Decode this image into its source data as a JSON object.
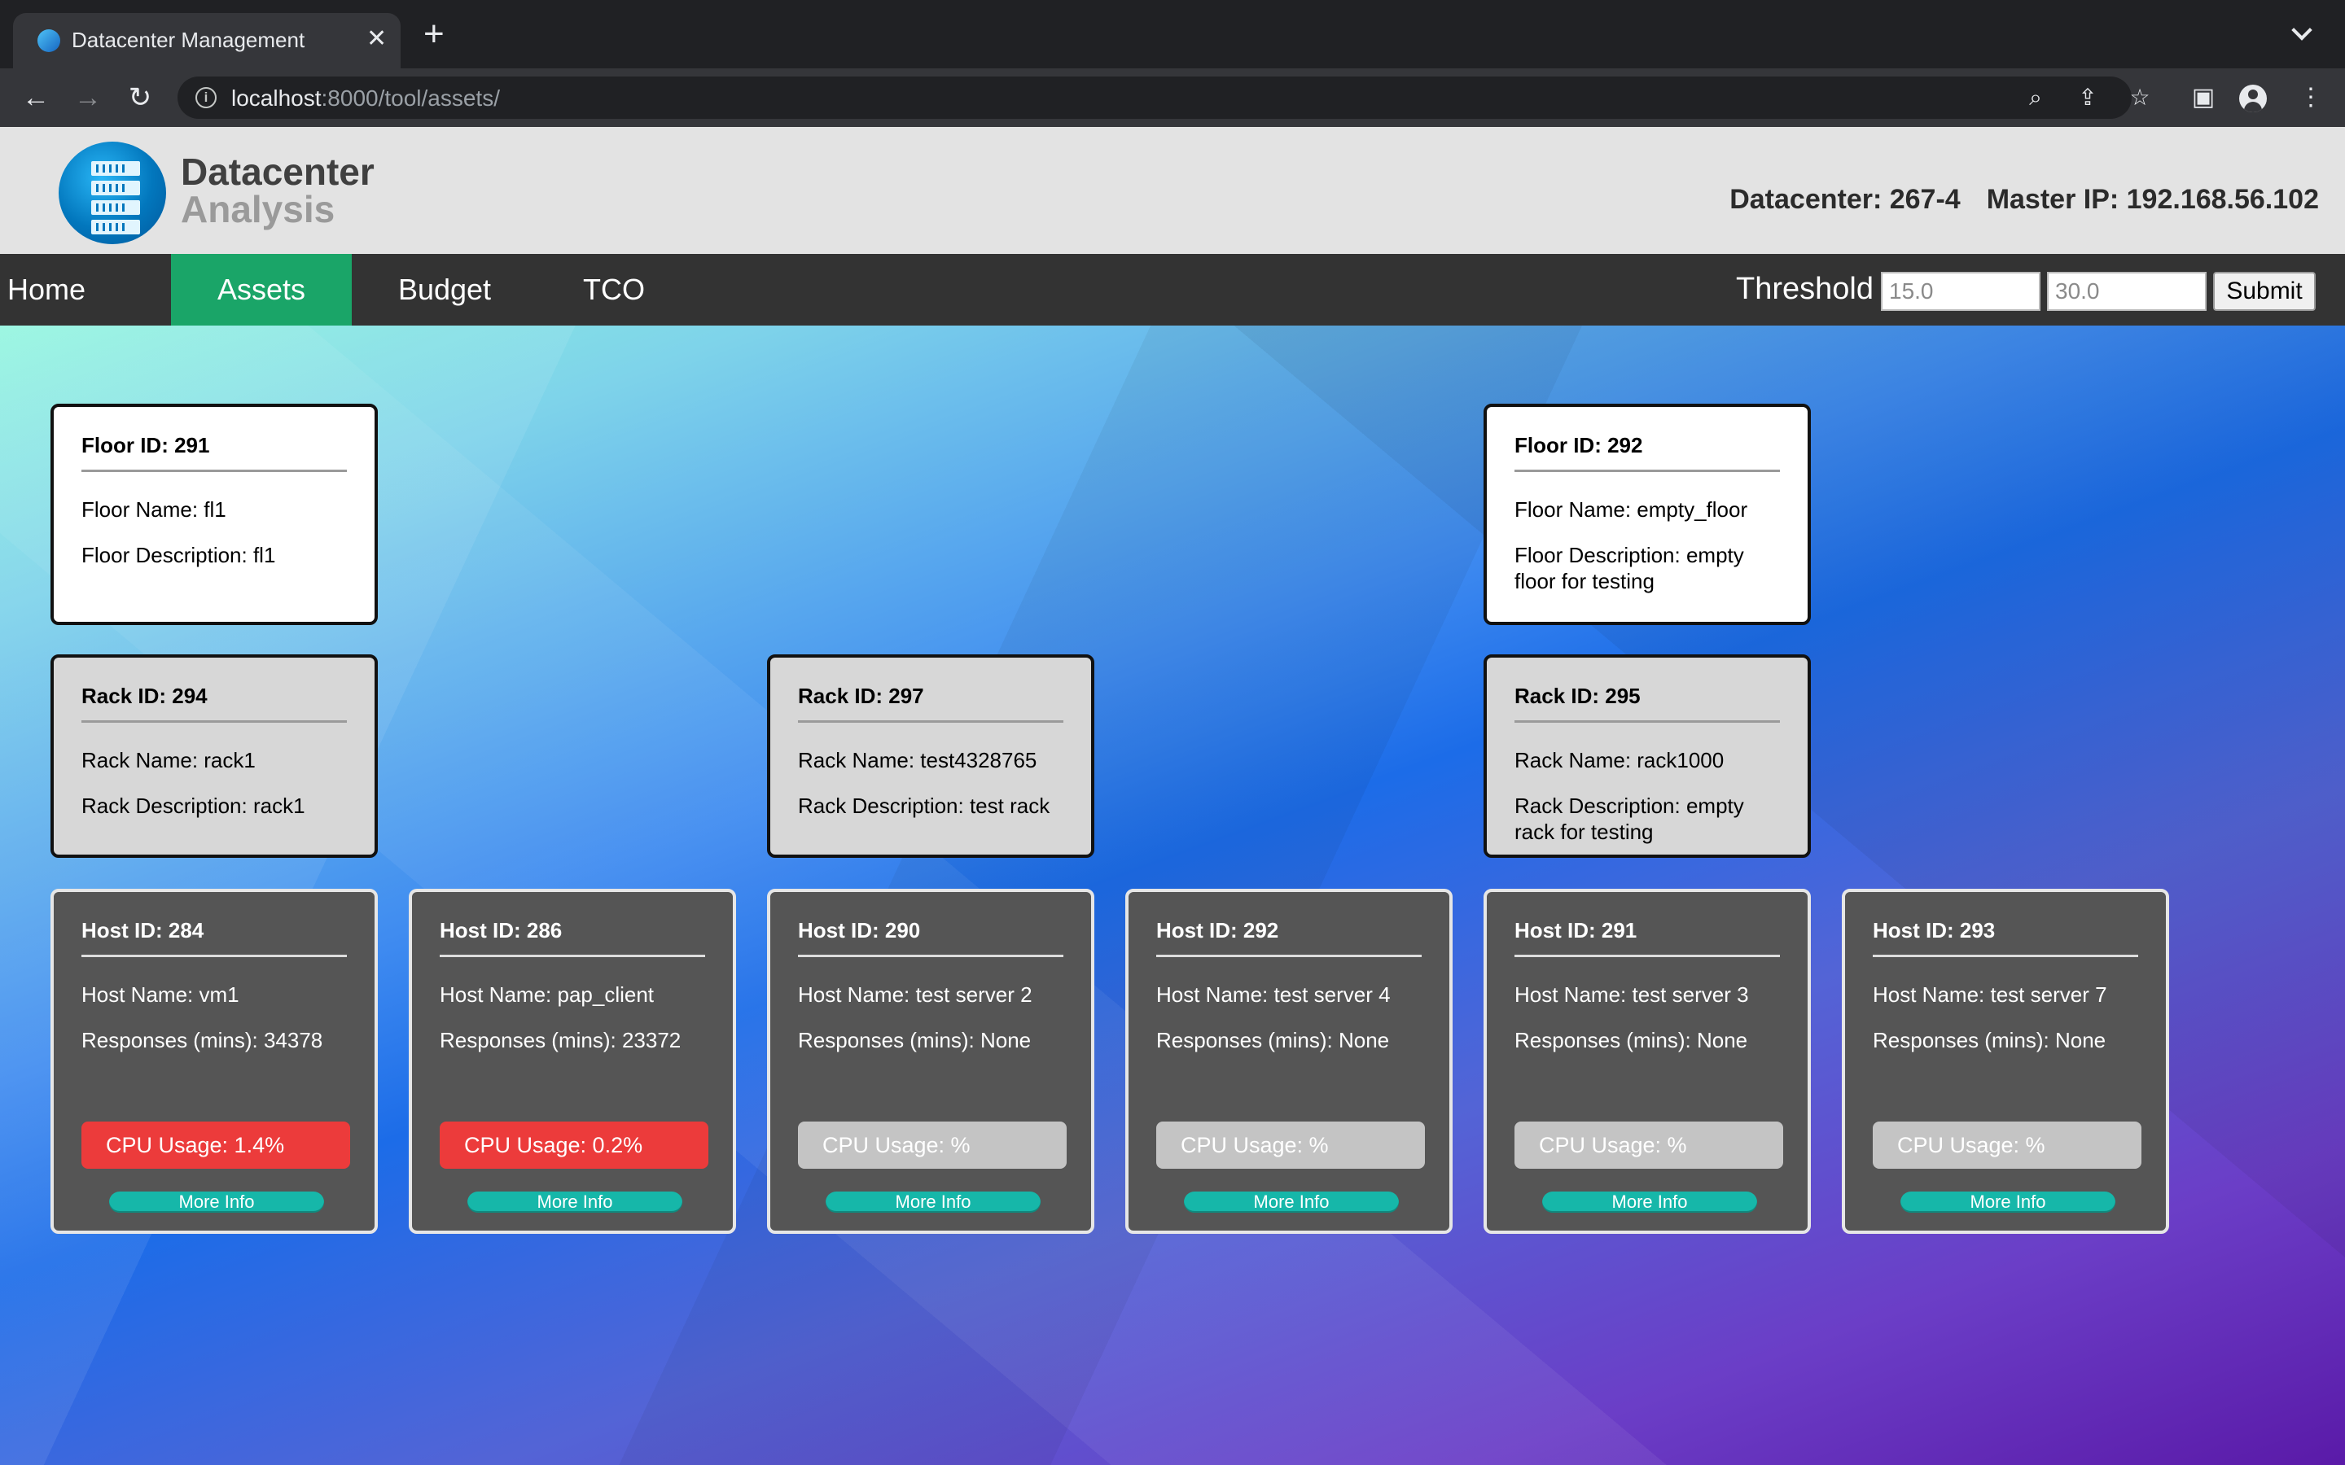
{
  "browser": {
    "tab_title": "Datacenter Management",
    "url_host": "localhost",
    "url_rest": ":8000/tool/assets/"
  },
  "header": {
    "logo_line1": "Datacenter",
    "logo_line2": "Analysis",
    "datacenter": "Datacenter: 267-4",
    "master_ip": "Master IP: 192.168.56.102"
  },
  "nav": {
    "items": [
      {
        "label": "Home",
        "active": false
      },
      {
        "label": "Assets",
        "active": true
      },
      {
        "label": "Budget",
        "active": false
      },
      {
        "label": "TCO",
        "active": false
      }
    ],
    "threshold_label": "Threshold",
    "threshold_low_placeholder": "15.0",
    "threshold_high_placeholder": "30.0",
    "submit_label": "Submit"
  },
  "floors": [
    {
      "title": "Floor ID: 291",
      "name": "Floor Name: fl1",
      "description": "Floor Description: fl1"
    },
    {
      "title": "Floor ID: 292",
      "name": "Floor Name: empty_floor",
      "description": "Floor Description: empty floor for testing"
    }
  ],
  "racks": [
    {
      "title": "Rack ID: 294",
      "name": "Rack Name: rack1",
      "description": "Rack Description: rack1"
    },
    {
      "title": "Rack ID: 297",
      "name": "Rack Name: test4328765",
      "description": "Rack Description: test rack"
    },
    {
      "title": "Rack ID: 295",
      "name": "Rack Name: rack1000",
      "description": "Rack Description: empty rack for testing"
    }
  ],
  "hosts": [
    {
      "title": "Host ID: 284",
      "name": "Host Name: vm1",
      "responses": "Responses (mins): 34378",
      "cpu": "CPU Usage: 1.4%",
      "cpu_status": "red",
      "more_info": "More Info"
    },
    {
      "title": "Host ID: 286",
      "name": "Host Name: pap_client",
      "responses": "Responses (mins): 23372",
      "cpu": "CPU Usage: 0.2%",
      "cpu_status": "red",
      "more_info": "More Info"
    },
    {
      "title": "Host ID: 290",
      "name": "Host Name: test server 2",
      "responses": "Responses (mins): None",
      "cpu": "CPU Usage: %",
      "cpu_status": "grey",
      "more_info": "More Info"
    },
    {
      "title": "Host ID: 292",
      "name": "Host Name: test server 4",
      "responses": "Responses (mins): None",
      "cpu": "CPU Usage: %",
      "cpu_status": "grey",
      "more_info": "More Info"
    },
    {
      "title": "Host ID: 291",
      "name": "Host Name: test server 3",
      "responses": "Responses (mins): None",
      "cpu": "CPU Usage: %",
      "cpu_status": "grey",
      "more_info": "More Info"
    },
    {
      "title": "Host ID: 293",
      "name": "Host Name: test server 7",
      "responses": "Responses (mins): None",
      "cpu": "CPU Usage: %",
      "cpu_status": "grey",
      "more_info": "More Info"
    }
  ],
  "colors": {
    "nav_active": "#1aa568",
    "cpu_alert": "#ec3b3b",
    "cpu_unknown": "#c4c4c4",
    "more_info": "#16b7a9"
  },
  "icons": {
    "back": "arrow-left-icon",
    "forward": "arrow-right-icon",
    "reload": "reload-icon",
    "info": "info-icon",
    "zoom": "zoom-icon",
    "share": "share-icon",
    "bookmark": "star-icon",
    "sidepanel": "side-panel-icon",
    "profile": "profile-icon",
    "menu": "kebab-menu-icon"
  }
}
